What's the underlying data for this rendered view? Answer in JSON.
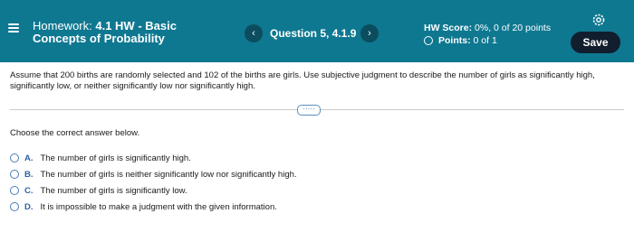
{
  "header": {
    "title_prefix": "Homework: ",
    "title_bold_line1": "4.1 HW - Basic",
    "title_line2": "Concepts of Probability",
    "question_label": "Question 5, 4.1.9",
    "prev_glyph": "‹",
    "next_glyph": "›",
    "score_label": "HW Score:",
    "score_value": "0%, 0 of 20 points",
    "points_label": "Points:",
    "points_value": "0 of 1",
    "save_label": "Save"
  },
  "question": {
    "text": "Assume that 200 births are randomly selected and 102 of the births are girls. Use subjective judgment to describe the number of girls as significantly high, significantly low, or neither significantly low nor significantly high.",
    "more_label": "·····"
  },
  "instruction": "Choose the correct answer below.",
  "options": [
    {
      "letter": "A.",
      "text": "The number of girls is significantly high."
    },
    {
      "letter": "B.",
      "text": "The number of girls is neither significantly low nor significantly high."
    },
    {
      "letter": "C.",
      "text": "The number of girls is significantly low."
    },
    {
      "letter": "D.",
      "text": "It is impossible to make a judgment with the given information."
    }
  ],
  "colors": {
    "header_bg": "#0f7891",
    "save_bg": "#101e2e",
    "accent": "#2a63a7"
  },
  "icons": {
    "menu": "menu-icon",
    "settings": "gear-icon",
    "prev": "chevron-left-icon",
    "next": "chevron-right-icon"
  }
}
